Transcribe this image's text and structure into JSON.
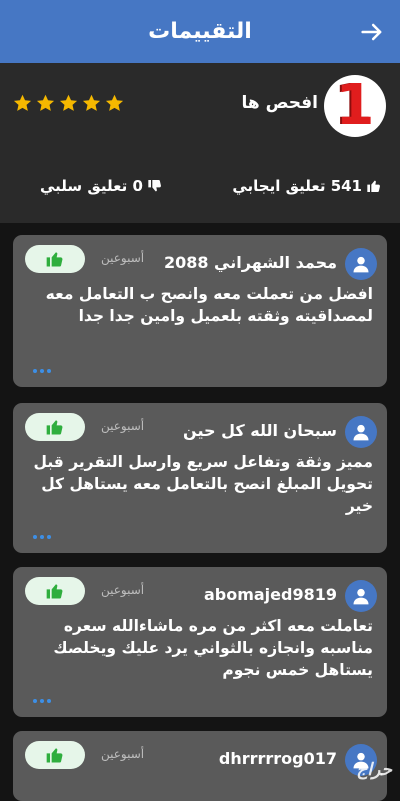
{
  "header": {
    "title": "التقييمات",
    "back_icon": "arrow-right-icon"
  },
  "profile": {
    "name": "افحص ها",
    "logo_text": "1",
    "rating_stars": 5
  },
  "counts": {
    "positive": "541 تعليق ايجابي",
    "negative": "0 تعليق سلبي"
  },
  "reviews": [
    {
      "user": "محمد الشهراني 2088",
      "time": "أسبوعين",
      "text": "افضل من تعملت معه وانصح ب التعامل معه لمصداقيته وثقته بلعميل وامين جدا جدا"
    },
    {
      "user": "سبحان الله كل حين",
      "time": "أسبوعين",
      "text": "مميز وثقة وتفاعل سريع وارسل التقرير قبل تحويل المبلغ انصح بالتعامل معه يستاهل كل خير"
    },
    {
      "user": "abomajed9819",
      "time": "أسبوعين",
      "text": "تعاملت معه اكثر من مره ماشاءالله سعره مناسبه وانجازه بالثواني يرد عليك ويخلصك يستاهل خمس نجوم"
    },
    {
      "user": "dhrrrrrog017",
      "time": "أسبوعين",
      "text": ""
    }
  ],
  "watermark": "حراج",
  "colors": {
    "header": "#4677c4",
    "star": "#f5b800",
    "like_bg": "#e6f6e9",
    "like_icon": "#2fae3e",
    "card": "#5a5a5a"
  }
}
